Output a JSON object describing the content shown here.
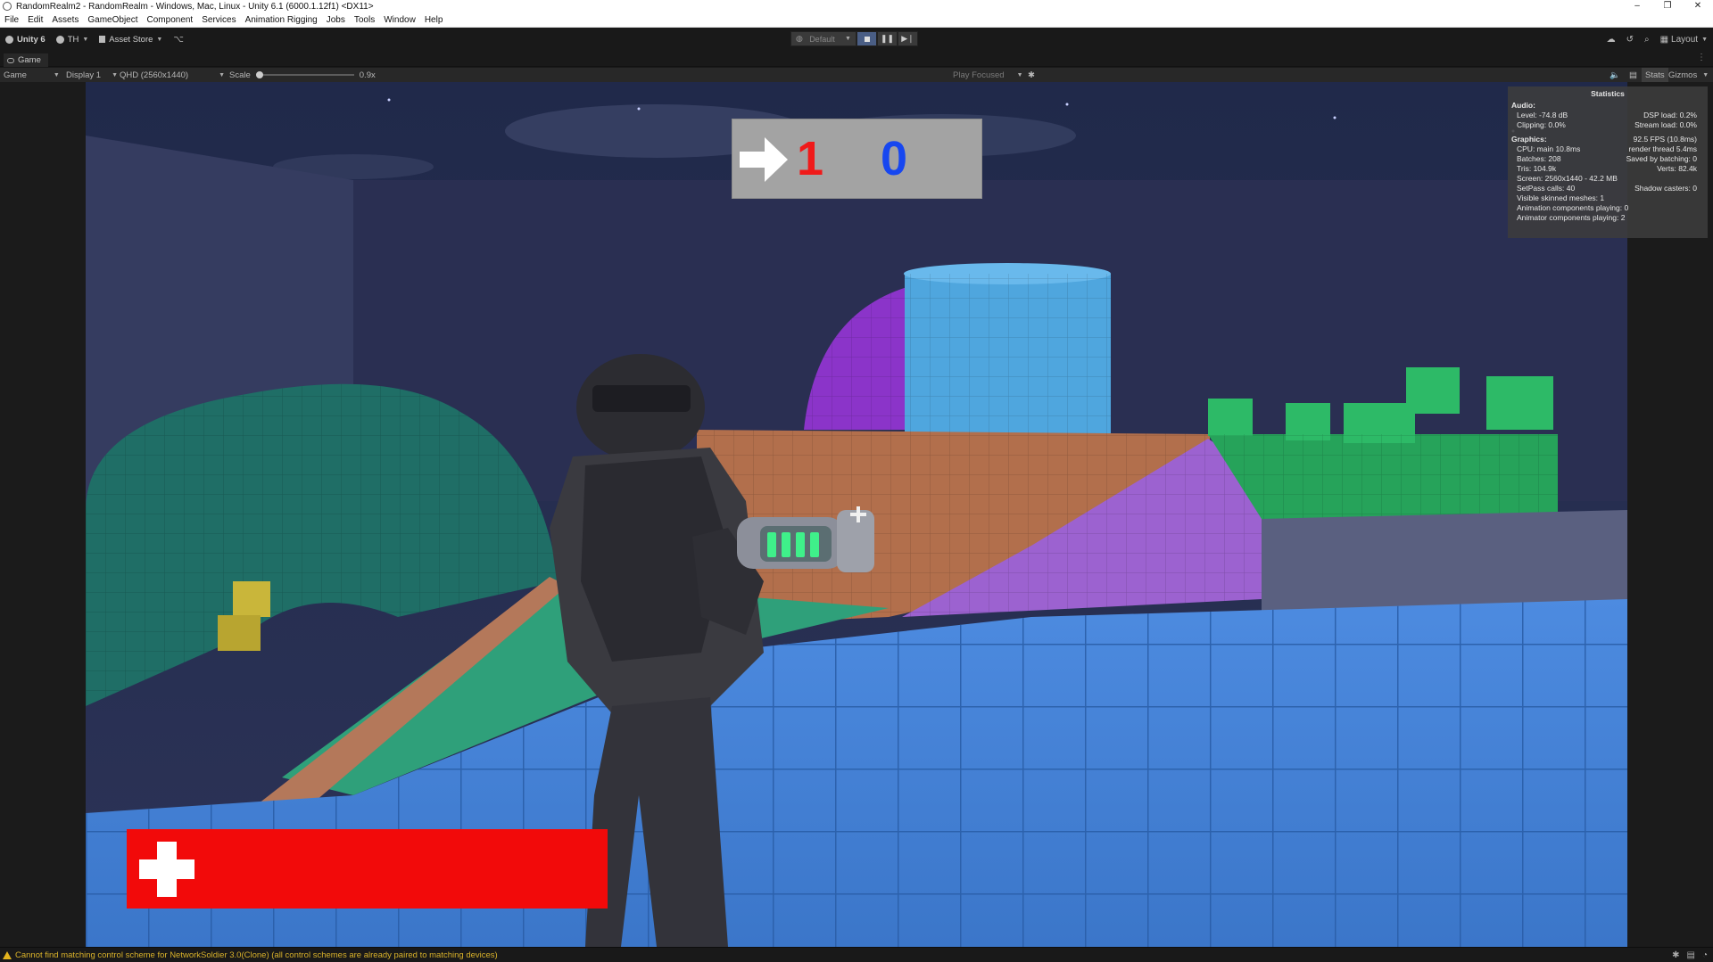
{
  "window": {
    "title": "RandomRealm2 - RandomRealm - Windows, Mac, Linux - Unity 6.1 (6000.1.12f1) <DX11>",
    "controls": [
      "–",
      "❐",
      "✕"
    ]
  },
  "menu": [
    "File",
    "Edit",
    "Assets",
    "GameObject",
    "Component",
    "Services",
    "Animation Rigging",
    "Jobs",
    "Tools",
    "Window",
    "Help"
  ],
  "toolbar": {
    "unity_label": "Unity 6",
    "account_label": "TH",
    "asset_store_label": "Asset Store",
    "build_profile": "Default",
    "layout_label": "Layout"
  },
  "tab": {
    "label": "Game"
  },
  "gameview": {
    "mode": "Game",
    "display": "Display 1",
    "resolution": "QHD (2560x1440)",
    "scale_label": "Scale",
    "scale_value": "0.9x",
    "play_mode": "Play Focused",
    "stats_label": "Stats",
    "gizmos_label": "Gizmos"
  },
  "hud": {
    "score_red": "1",
    "score_blue": "0",
    "colors": {
      "red": "#f01a1a",
      "blue": "#1747f0",
      "health": "#f20a0a"
    }
  },
  "stats": {
    "title": "Statistics",
    "audio_header": "Audio:",
    "level": "Level: -74.8 dB",
    "dsp_load": "DSP load: 0.2%",
    "clipping": "Clipping: 0.0%",
    "stream_load": "Stream load: 0.0%",
    "graphics_header": "Graphics:",
    "fps": "92.5 FPS (10.8ms)",
    "cpu_main": "CPU: main 10.8ms",
    "render_thread": "render thread 5.4ms",
    "batches": "Batches: 208",
    "saved_batching": "Saved by batching: 0",
    "tris": "Tris: 104.9k",
    "verts": "Verts: 82.4k",
    "screen": "Screen: 2560x1440 - 42.2 MB",
    "setpass": "SetPass calls: 40",
    "shadow_casters": "Shadow casters: 0",
    "skinned_meshes": "Visible skinned meshes: 1",
    "anim_components": "Animation components playing: 0",
    "animator_components": "Animator components playing: 2"
  },
  "status": {
    "message": "Cannot find matching control scheme for NetworkSoldier 3.0(Clone) (all control schemes are already paired to matching devices)"
  }
}
